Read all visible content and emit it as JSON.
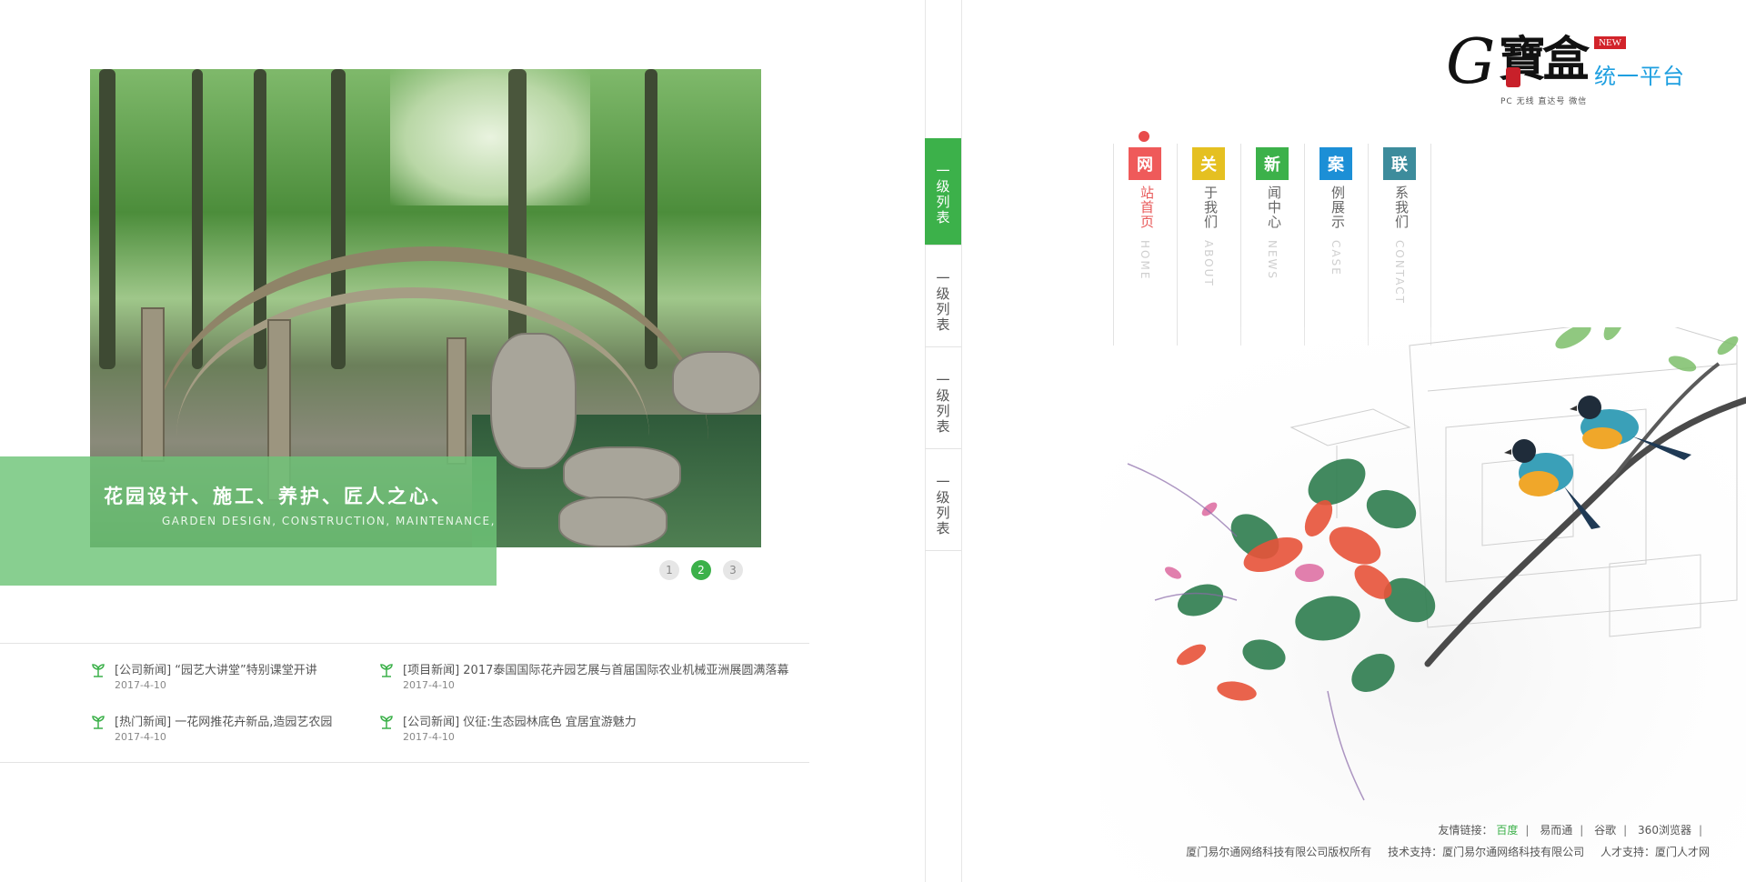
{
  "hero": {
    "caption_cn": "花园设计、施工、养护、匠人之心、",
    "caption_en": "GARDEN DESIGN, CONSTRUCTION, MAINTENANCE,",
    "pages": [
      "1",
      "2",
      "3"
    ],
    "active_page": "2"
  },
  "news": [
    {
      "title": "[公司新闻] “园艺大讲堂”特别课堂开讲",
      "date": "2017-4-10"
    },
    {
      "title": "[项目新闻] 2017泰国国际花卉园艺展与首届国际农业机械亚洲展圆满落幕",
      "date": "2017-4-10"
    },
    {
      "title": "[热门新闻] 一花网推花卉新品,造园艺农园",
      "date": "2017-4-10"
    },
    {
      "title": "[公司新闻] 仪征:生态园林底色 宜居宜游魅力",
      "date": "2017-4-10"
    }
  ],
  "side_list": [
    "一级列表",
    "一级列表",
    "一级列表",
    "一级列表"
  ],
  "logo": {
    "g": "G",
    "brand": "寶盒",
    "new_badge": "NEW",
    "platform": "统一平台",
    "sub": "PC 无线 直达号 微信"
  },
  "nav": [
    {
      "first": "网",
      "rest": "站首页",
      "en": "HOME",
      "color": "#ef5a5a",
      "active": true
    },
    {
      "first": "关",
      "rest": "于我们",
      "en": "ABOUT",
      "color": "#e5c021",
      "active": false
    },
    {
      "first": "新",
      "rest": "闻中心",
      "en": "NEWS",
      "color": "#3cb14a",
      "active": false
    },
    {
      "first": "案",
      "rest": "例展示",
      "en": "CASE",
      "color": "#1c8fd6",
      "active": false
    },
    {
      "first": "联",
      "rest": "系我们",
      "en": "CONTACT",
      "color": "#3d8c9c",
      "active": false
    }
  ],
  "footer": {
    "links_label": "友情链接：",
    "links": [
      "百度",
      "易而通",
      "谷歌",
      "360浏览器"
    ],
    "copyright": "厦门易尔通网络科技有限公司版权所有",
    "tech": "技术支持：厦门易尔通网络科技有限公司",
    "talent": "人才支持：厦门人才网"
  },
  "colors": {
    "accent": "#3cb14a",
    "caption_bg": "#6ec478",
    "platform_blue": "#1e9fe0",
    "badge_red": "#d2232a"
  }
}
